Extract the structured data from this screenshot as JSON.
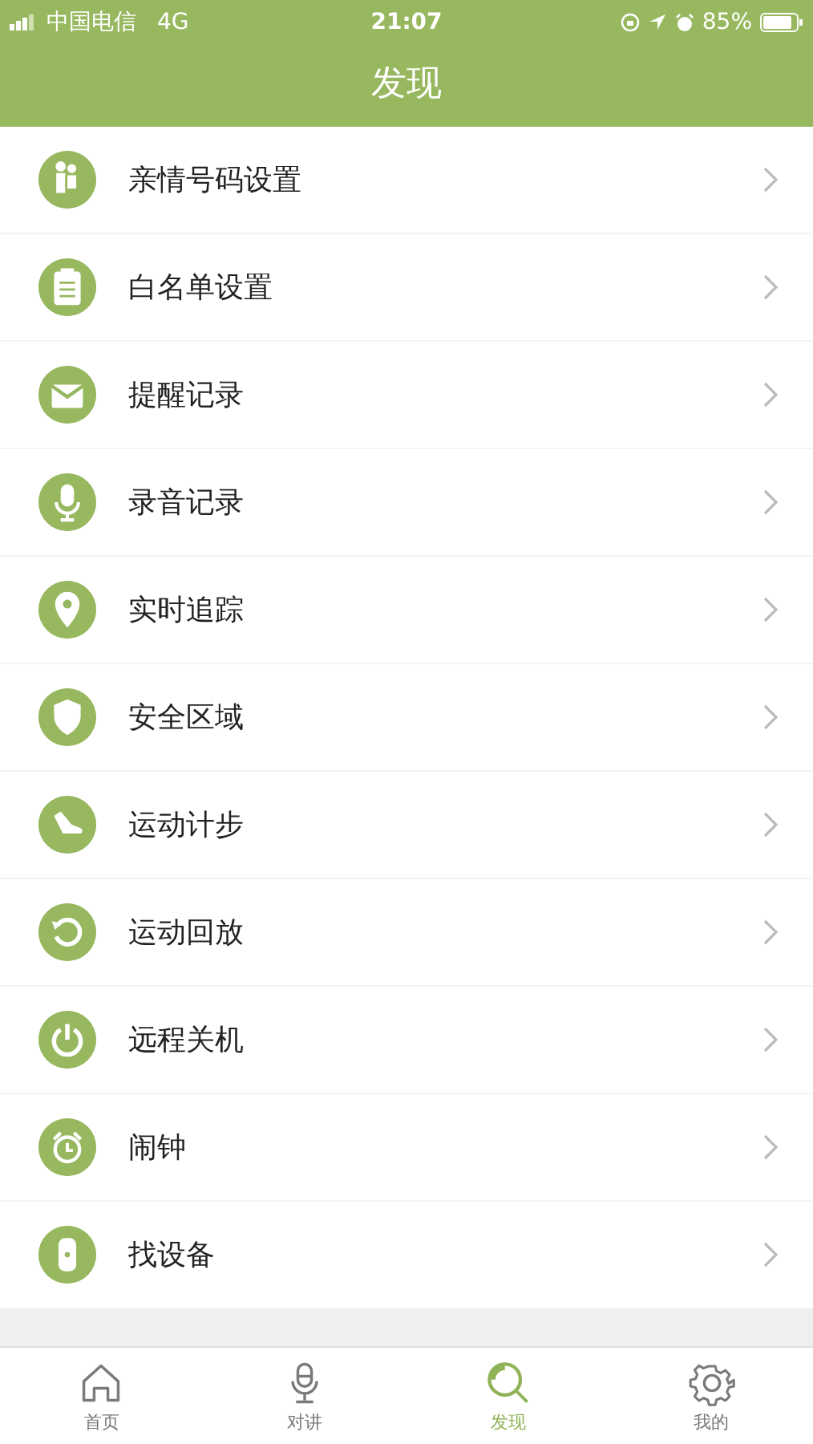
{
  "status_bar": {
    "carrier": "中国电信",
    "network": "4G",
    "time": "21:07",
    "battery": "85%"
  },
  "header": {
    "title": "发现"
  },
  "items": [
    {
      "label": "亲情号码设置"
    },
    {
      "label": "白名单设置"
    },
    {
      "label": "提醒记录"
    },
    {
      "label": "录音记录"
    },
    {
      "label": "实时追踪"
    },
    {
      "label": "安全区域"
    },
    {
      "label": "运动计步"
    },
    {
      "label": "运动回放"
    },
    {
      "label": "远程关机"
    },
    {
      "label": "闹钟"
    },
    {
      "label": "找设备"
    }
  ],
  "tabs": [
    {
      "label": "首页",
      "selected": false
    },
    {
      "label": "对讲",
      "selected": false
    },
    {
      "label": "发现",
      "selected": true
    },
    {
      "label": "我的",
      "selected": false
    }
  ]
}
